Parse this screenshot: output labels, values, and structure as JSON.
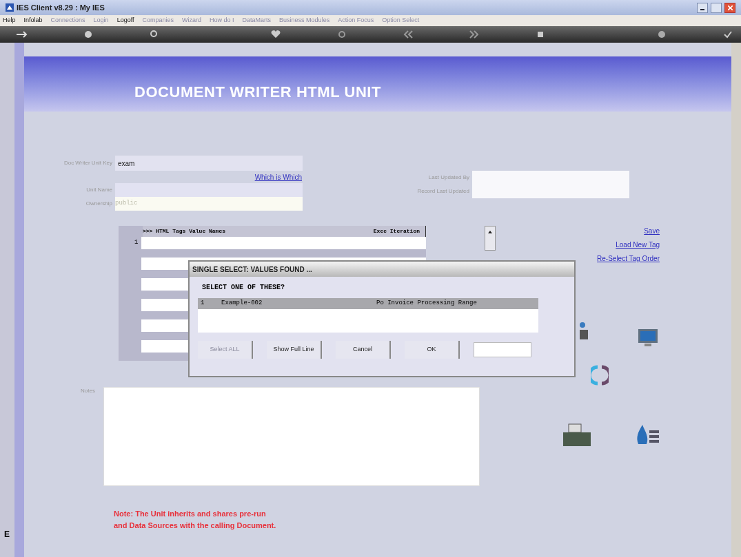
{
  "window": {
    "title": "IES Client v8.29 : My IES"
  },
  "menu": [
    {
      "label": "Help",
      "disabled": false
    },
    {
      "label": "Infolab",
      "disabled": false
    },
    {
      "label": "Connections",
      "disabled": true
    },
    {
      "label": "Login",
      "disabled": true
    },
    {
      "label": "Logoff",
      "disabled": false
    },
    {
      "label": "Companies",
      "disabled": true
    },
    {
      "label": "Wizard",
      "disabled": true
    },
    {
      "label": "How do I",
      "disabled": true
    },
    {
      "label": "DataMarts",
      "disabled": true
    },
    {
      "label": "Business Modules",
      "disabled": true
    },
    {
      "label": "Action Focus",
      "disabled": true
    },
    {
      "label": "Option Select",
      "disabled": true
    }
  ],
  "header": {
    "title": "DOCUMENT WRITER HTML UNIT"
  },
  "form": {
    "unit_key": {
      "label": "Doc Writer Unit Key",
      "value": "exam"
    },
    "which_link": "Which is Which",
    "unit_name": {
      "label": "Unit Name"
    },
    "ownership": {
      "label": "Ownership",
      "value": "public"
    },
    "last_updated_by": {
      "label": "Last Updated By"
    },
    "record_last_updated": {
      "label": "Record Last Updated"
    }
  },
  "table": {
    "columns": [
      ">>> HTML Tags  Value Names",
      "Exec Iteration"
    ],
    "rows": [
      "1",
      "",
      "",
      "",
      "",
      ""
    ]
  },
  "links": [
    "Save",
    "Load New Tag",
    "Re-Select Tag Order"
  ],
  "dialog": {
    "title": "SINGLE SELECT: VALUES FOUND ...",
    "prompt": "SELECT ONE OF THESE?",
    "items": [
      {
        "number": "1",
        "name": "Example-002",
        "description": "Po Invoice Processing Range",
        "selected": true
      }
    ],
    "buttons": [
      {
        "label": "Select ALL",
        "disabled": true
      },
      {
        "label": "Show Full Line",
        "disabled": false
      },
      {
        "label": "Cancel",
        "disabled": false
      },
      {
        "label": "OK",
        "disabled": false
      }
    ]
  },
  "notes": {
    "label": "Notes"
  },
  "note": [
    "Note: The Unit inherits and shares pre-run",
    "and Data Sources with the calling Document."
  ],
  "side_letter": "E"
}
